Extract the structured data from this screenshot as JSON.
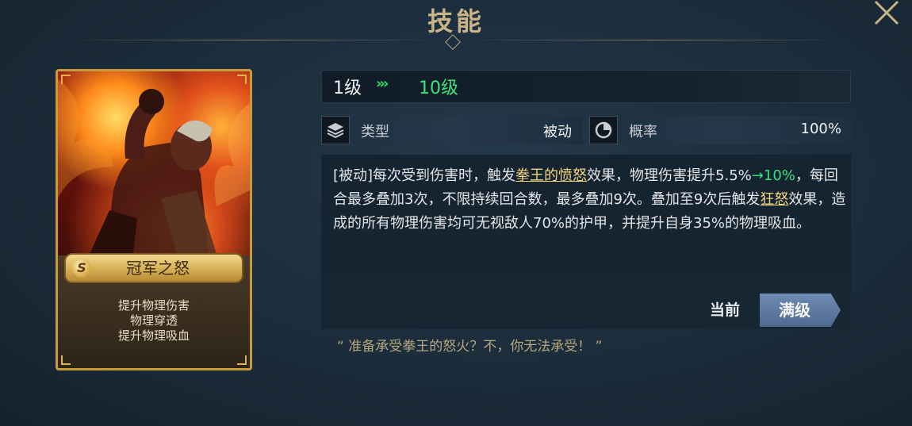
{
  "header": {
    "title": "技能"
  },
  "card": {
    "rank": "S",
    "name": "冠军之怒",
    "tags": [
      "提升物理伤害",
      "物理穿透",
      "提升物理吸血"
    ]
  },
  "level": {
    "from": "1级",
    "arrows": "›››",
    "to": "10级"
  },
  "info": [
    {
      "icon": "layers-icon",
      "label": "类型",
      "value": "被动"
    },
    {
      "icon": "pie-chart-icon",
      "label": "概率",
      "value": "100%"
    }
  ],
  "description": {
    "p1": "[被动]每次受到伤害时，触发",
    "link1": "拳王的愤怒",
    "p2": "效果，物理伤害提升5.5%",
    "green": "→10%",
    "p3": "，每回合最多叠加3次，不限持续回合数，最多叠加9次。叠加至9次后触发",
    "link2": "狂怒",
    "p4": "效果，造成的所有物理伤害均可无视敌人70%的护甲，并提升自身35%的物理吸血。"
  },
  "buttons": {
    "current": "当前",
    "max": "满级"
  },
  "quote": "“ 准备承受拳王的怒火？不，你无法承受！ ”",
  "colors": {
    "accent_gold": "#c9b48a",
    "level_green": "#38e07a",
    "link_gold": "#f3d57c"
  }
}
